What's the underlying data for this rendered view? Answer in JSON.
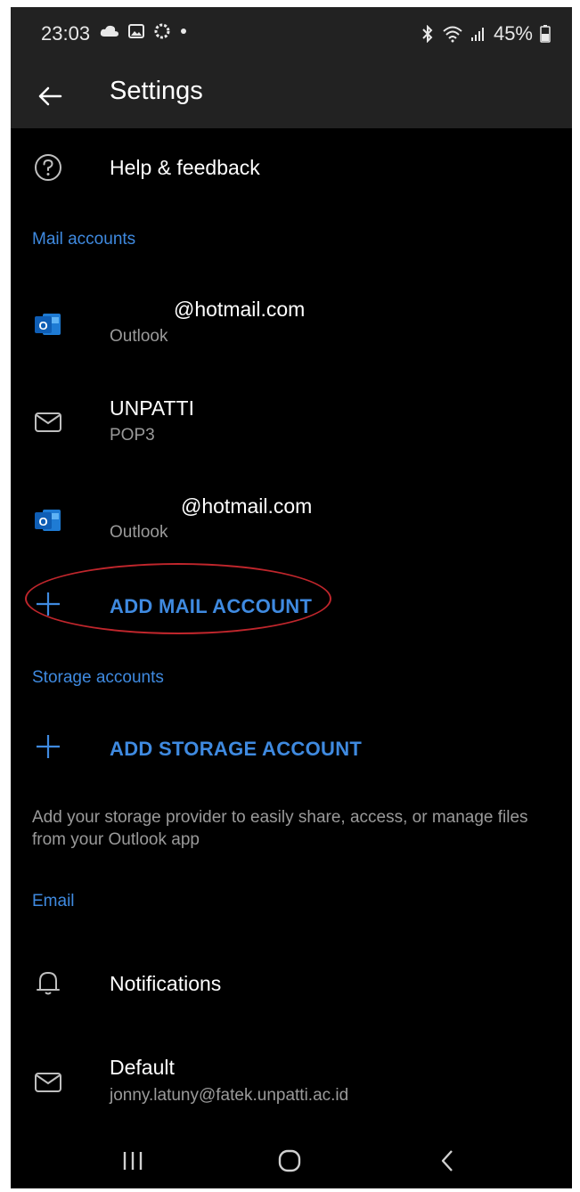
{
  "status_bar": {
    "time": "23:03",
    "battery": "45%",
    "left_icons": [
      "cloud-icon",
      "image-icon",
      "sync-icon",
      "dot-icon"
    ],
    "right_icons": [
      "bluetooth-icon",
      "wifi-icon",
      "signal-icon",
      "battery-icon"
    ]
  },
  "toolbar": {
    "title": "Settings"
  },
  "help": {
    "label": "Help & feedback"
  },
  "mail_accounts": {
    "header": "Mail accounts",
    "items": [
      {
        "primary": "@hotmail.com",
        "secondary": "Outlook",
        "icon": "outlook-icon"
      },
      {
        "primary": "UNPATTI",
        "secondary": "POP3",
        "icon": "mail-icon"
      },
      {
        "primary": "@hotmail.com",
        "secondary": "Outlook",
        "icon": "outlook-icon"
      }
    ],
    "add_label": "ADD MAIL ACCOUNT"
  },
  "storage_accounts": {
    "header": "Storage accounts",
    "add_label": "ADD STORAGE ACCOUNT",
    "description": "Add your storage provider to easily share, access, or manage files from your Outlook app"
  },
  "email": {
    "header": "Email",
    "notifications_label": "Notifications",
    "default_label": "Default",
    "default_value": "jonny.latuny@fatek.unpatti.ac.id"
  },
  "colors": {
    "accent": "#3f8ae0",
    "background": "#000000",
    "toolbar": "#222222",
    "highlight_ring": "#c0262c"
  }
}
